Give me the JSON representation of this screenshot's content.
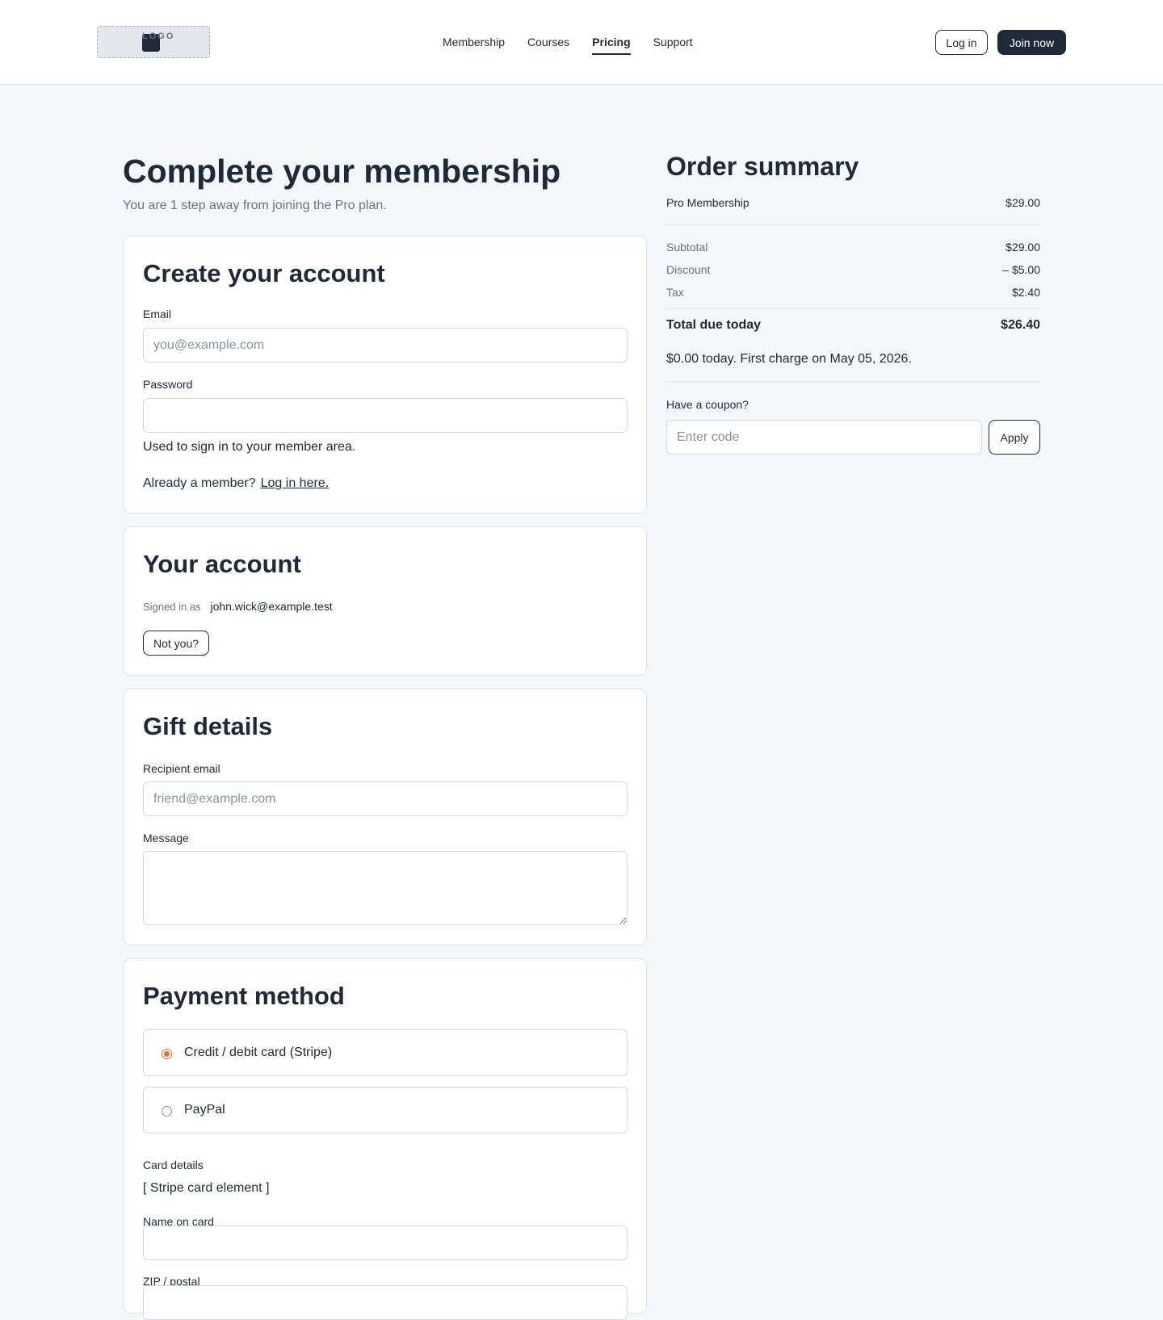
{
  "header": {
    "logo_text": "LOGO",
    "nav": [
      {
        "label": "Membership"
      },
      {
        "label": "Courses"
      },
      {
        "label": "Pricing",
        "active": true
      },
      {
        "label": "Support"
      }
    ],
    "login_label": "Log in",
    "join_label": "Join now"
  },
  "page": {
    "title": "Complete your membership",
    "subtitle": "You are 1 step away from joining the Pro plan."
  },
  "create_account": {
    "title": "Create your account",
    "email_label": "Email",
    "email_placeholder": "you@example.com",
    "password_label": "Password",
    "password_help": "Used to sign in to your member area.",
    "member_prompt": "Already a member?",
    "login_link": "Log in here."
  },
  "your_account": {
    "title": "Your account",
    "signed_in_label": "Signed in as",
    "email": "john.wick@example.test",
    "not_you_label": "Not you?"
  },
  "gift": {
    "title": "Gift details",
    "recipient_label": "Recipient email",
    "recipient_placeholder": "friend@example.com",
    "message_label": "Message"
  },
  "payment": {
    "title": "Payment method",
    "options": [
      {
        "label": "Credit / debit card (Stripe)",
        "selected": true
      },
      {
        "label": "PayPal",
        "selected": false
      }
    ],
    "card_details_label": "Card details",
    "card_element_text": "[ Stripe card element ]",
    "name_label": "Name on card",
    "zip_label": "ZIP / postal"
  },
  "summary": {
    "title": "Order summary",
    "item": {
      "label": "Pro Membership",
      "value": "$29.00"
    },
    "subtotal": {
      "label": "Subtotal",
      "value": "$29.00"
    },
    "discount": {
      "label": "Discount",
      "value": "– $5.00"
    },
    "tax": {
      "label": "Tax",
      "value": "$2.40"
    },
    "total": {
      "label": "Total due today",
      "value": "$26.40"
    },
    "first_charge": "$0.00 today. First charge on May 05, 2026.",
    "coupon_label": "Have a coupon?",
    "coupon_placeholder": "Enter code",
    "apply_label": "Apply"
  },
  "colors": {
    "primary": "#1f2937",
    "page_bg": "#f4f7fa",
    "radio_accent": "#e0723a"
  }
}
